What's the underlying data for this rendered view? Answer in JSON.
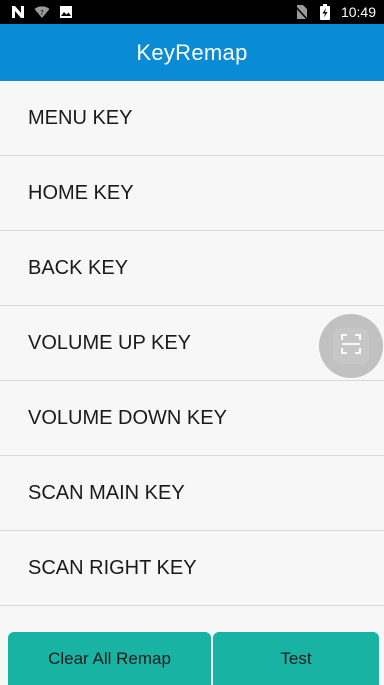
{
  "status_bar": {
    "left_icons": [
      "notification-n-icon",
      "wifi-question-icon",
      "image-icon"
    ],
    "right_icons": [
      "no-sim-icon",
      "battery-charging-icon"
    ],
    "time": "10:49"
  },
  "app_bar": {
    "title": "KeyRemap",
    "color": "#0a8bd6"
  },
  "key_list": [
    {
      "label": "MENU KEY"
    },
    {
      "label": "HOME KEY"
    },
    {
      "label": "BACK KEY"
    },
    {
      "label": "VOLUME UP KEY"
    },
    {
      "label": "VOLUME DOWN KEY"
    },
    {
      "label": "SCAN MAIN KEY"
    },
    {
      "label": "SCAN RIGHT KEY"
    }
  ],
  "floating_button": {
    "icon": "scan-frame-icon"
  },
  "buttons": {
    "clear_all_label": "Clear All Remap",
    "test_label": "Test",
    "color": "#19b3a4"
  }
}
